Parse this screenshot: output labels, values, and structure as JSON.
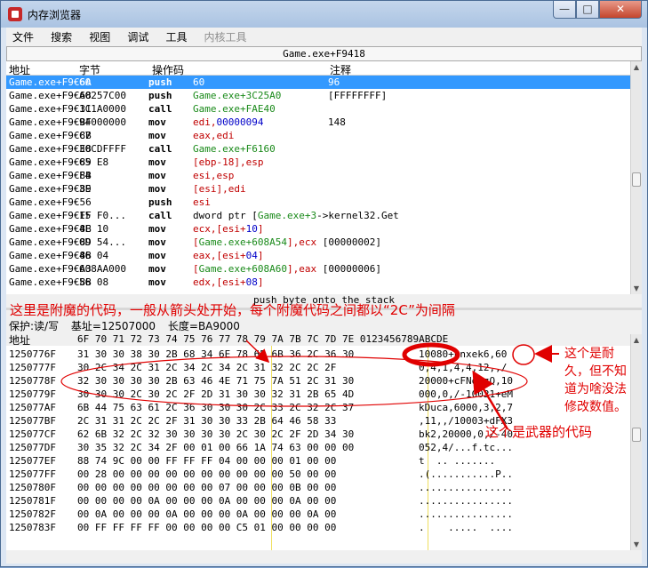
{
  "window": {
    "title": "内存浏览器",
    "min": "—",
    "max": "□",
    "close": "✕"
  },
  "menu": [
    "文件",
    "搜索",
    "视图",
    "调试",
    "工具",
    "内核工具"
  ],
  "disasm": {
    "header": "Game.exe+F9418",
    "columns": {
      "address": "地址",
      "bytes": "字节",
      "opcode": "操作码",
      "comment": "注释"
    },
    "rows": [
      {
        "addr": "Game.exe+F9€6A",
        "bytes": "60",
        "op": "push",
        "args": [
          {
            "t": "60",
            "c": "g"
          }
        ],
        "cmt": "96",
        "selected": true
      },
      {
        "addr": "Game.exe+F9€68",
        "bytes": "A0257C00",
        "op": "push",
        "args": [
          {
            "t": "Game.exe+3C25A0",
            "c": "g"
          }
        ],
        "cmt": "[FFFFFFFF]"
      },
      {
        "addr": "Game.exe+F9€31",
        "bytes": "1C1A0000",
        "op": "call",
        "args": [
          {
            "t": "Game.exe+FAE40",
            "c": "g"
          }
        ],
        "cmt": ""
      },
      {
        "addr": "Game.exe+F9€BF",
        "bytes": "94000000",
        "op": "mov",
        "args": [
          {
            "t": "edi,",
            "c": "r"
          },
          {
            "t": "00000094",
            "c": "b"
          }
        ],
        "cmt": "148"
      },
      {
        "addr": "Game.exe+F9€8B",
        "bytes": "C7",
        "op": "mov",
        "args": [
          {
            "t": "eax,edi",
            "c": "r"
          }
        ],
        "cmt": ""
      },
      {
        "addr": "Game.exe+F9€E8",
        "bytes": "30CDFFFF",
        "op": "call",
        "args": [
          {
            "t": "Game.exe+F6160",
            "c": "g"
          }
        ],
        "cmt": ""
      },
      {
        "addr": "Game.exe+F9€89",
        "bytes": "65 E8",
        "op": "mov",
        "args": [
          {
            "t": "[ebp-18],esp",
            "c": "r"
          }
        ],
        "cmt": ""
      },
      {
        "addr": "Game.exe+F9€8B",
        "bytes": "F4",
        "op": "mov",
        "args": [
          {
            "t": "esi,esp",
            "c": "r"
          }
        ],
        "cmt": ""
      },
      {
        "addr": "Game.exe+F9€89",
        "bytes": "3E",
        "op": "mov",
        "args": [
          {
            "t": "[esi],edi",
            "c": "r"
          }
        ],
        "cmt": ""
      },
      {
        "addr": "Game.exe+F9€56",
        "bytes": "",
        "op": "push",
        "args": [
          {
            "t": "esi",
            "c": "r"
          }
        ],
        "cmt": ""
      },
      {
        "addr": "Game.exe+F9€FF",
        "bytes": "15 F0...",
        "op": "call",
        "args": [
          {
            "t": "dword ptr [",
            "c": ""
          },
          {
            "t": "Game.exe+3",
            "c": "g"
          },
          {
            "t": "->kernel32.Get",
            "c": ""
          }
        ],
        "cmt": ""
      },
      {
        "addr": "Game.exe+F9€8B",
        "bytes": "4E 10",
        "op": "mov",
        "args": [
          {
            "t": "ecx,[esi+",
            "c": "r"
          },
          {
            "t": "10",
            "c": "b"
          },
          {
            "t": "]",
            "c": "r"
          }
        ],
        "cmt": ""
      },
      {
        "addr": "Game.exe+F9€89",
        "bytes": "0D 54...",
        "op": "mov",
        "args": [
          {
            "t": "[",
            "c": "r"
          },
          {
            "t": "Game.exe+608A54",
            "c": "g"
          },
          {
            "t": "],ecx",
            "c": "r"
          },
          {
            "t": " [00000002]",
            "c": ""
          }
        ],
        "cmt": ""
      },
      {
        "addr": "Game.exe+F9€8B",
        "bytes": "46 04",
        "op": "mov",
        "args": [
          {
            "t": "eax,[esi+",
            "c": "r"
          },
          {
            "t": "04",
            "c": "b"
          },
          {
            "t": "]",
            "c": "r"
          }
        ],
        "cmt": ""
      },
      {
        "addr": "Game.exe+F9€A3",
        "bytes": "608AA000",
        "op": "mov",
        "args": [
          {
            "t": "[",
            "c": "r"
          },
          {
            "t": "Game.exe+608A60",
            "c": "g"
          },
          {
            "t": "],eax",
            "c": "r"
          },
          {
            "t": " [00000006]",
            "c": ""
          }
        ],
        "cmt": ""
      },
      {
        "addr": "Game.exe+F9€8B",
        "bytes": "56 08",
        "op": "mov",
        "args": [
          {
            "t": "edx,[esi+",
            "c": "r"
          },
          {
            "t": "08",
            "c": "b"
          },
          {
            "t": "]",
            "c": "r"
          }
        ],
        "cmt": ""
      }
    ]
  },
  "status": "push byte onto the stack",
  "hex": {
    "protection": "保护:读/写",
    "base": "基址=12507000",
    "length": "长度=BA9000",
    "addr_header": "地址",
    "col_header": "6F 70 71 72 73 74 75 76 77 78 79 7A 7B 7C 7D 7E 0123456789ABCDE",
    "rows": [
      {
        "addr": "1250776F",
        "bytes": "31 30 30 38 30 2B 68 34 6E 78 65 6B 36 2C 36 30",
        "ascii": "10080+hnxek6,60"
      },
      {
        "addr": "1250777F",
        "bytes": "30 2C 34 2C 31 2C 34 2C 34 2C 31 32 2C 2C 2F",
        "ascii": "0,4,1,4,4,12,,/"
      },
      {
        "addr": "1250778F",
        "bytes": "32 30 30 30 30 2B 63 46 4E 71 75 7A 51 2C 31 30",
        "ascii": "20000+cFNquzQ,10"
      },
      {
        "addr": "1250779F",
        "bytes": "30 30 30 2C 30 2C 2F 2D 31 30 30 32 31 2B 65 4D",
        "ascii": "000,0,/-10021+eM"
      },
      {
        "addr": "125077AF",
        "bytes": "6B 44 75 63 61 2C 36 30 30 30 2C 33 2C 32 2C 37",
        "ascii": "kDuca,6000,3,2,7"
      },
      {
        "addr": "125077BF",
        "bytes": "2C 31 31 2C 2C 2F 31 30 30 33 2B 64 46 58 33",
        "ascii": ",11,,/10003+dFX3"
      },
      {
        "addr": "125077CF",
        "bytes": "62 6B 32 2C 32 30 30 30 30 2C 30 2C 2F 2D 34 30",
        "ascii": "bk2,20000,0,/-40"
      },
      {
        "addr": "125077DF",
        "bytes": "30 35 32 2C 34 2F 00 01 00 66 1A 74 63 00 00 00",
        "ascii": "052,4/...f.tc..."
      },
      {
        "addr": "125077EF",
        "bytes": "88 74 9C 00 00 FF FF FF 04 00 00 00 01 00 00",
        "ascii": "t  .. ......."
      },
      {
        "addr": "125077FF",
        "bytes": "00 28 00 00 00 00 00 00 00 00 00 00 50 00 00",
        "ascii": ".(...........P.."
      },
      {
        "addr": "1250780F",
        "bytes": "00 00 00 00 00 00 00 00 07 00 00 00 0B 00 00",
        "ascii": "................"
      },
      {
        "addr": "1250781F",
        "bytes": "00 00 00 00 0A 00 00 00 0A 00 00 00 0A 00 00",
        "ascii": "................"
      },
      {
        "addr": "1250782F",
        "bytes": "00 0A 00 00 00 0A 00 00 00 0A 00 00 00 0A 00",
        "ascii": "................"
      },
      {
        "addr": "1250783F",
        "bytes": "00 FF FF FF FF 00 00 00 00 C5 01 00 00 00 00",
        "ascii": ".    .....  ...."
      }
    ]
  },
  "annotations": {
    "note_top": "这里是附魔的代码，一般从箭头处开始，每个附魔代码之间都以“2C”为间隔",
    "note_durability_1": "这个是耐",
    "note_durability_2": "久，但不知",
    "note_durability_3": "道为啥没法",
    "note_durability_4": "修改数值。",
    "note_weapon": "这个是武器的代码",
    "color": "#e00000"
  }
}
